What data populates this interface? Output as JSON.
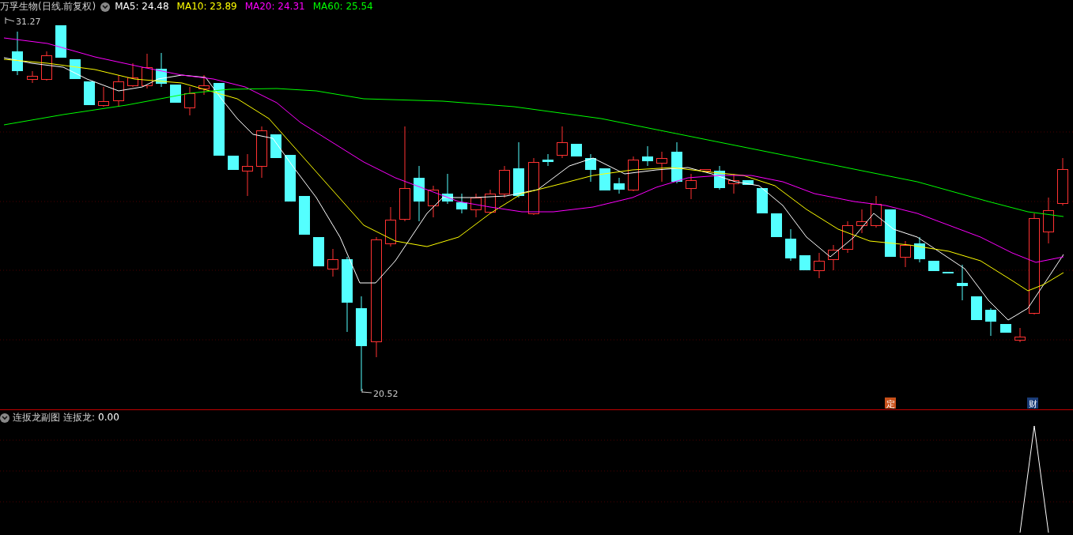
{
  "main_chart": {
    "title": "万孚生物(日线.前复权)",
    "indicators": [
      {
        "label": "MA5: 24.48",
        "color": "#ffffff"
      },
      {
        "label": "MA10: 23.89",
        "color": "#ffff00"
      },
      {
        "label": "MA20: 24.31",
        "color": "#ff00ff"
      },
      {
        "label": "MA60: 25.54",
        "color": "#00ff00"
      }
    ],
    "high_label": "31.27",
    "low_label": "20.52",
    "event_markers": [
      {
        "text": "定",
        "color": "#c8501a"
      },
      {
        "text": "财",
        "color": "#1a3c78"
      }
    ]
  },
  "sub_chart": {
    "title": "连扳龙副图",
    "indicator_label": "连扳龙:",
    "indicator_value": "0.00"
  }
}
